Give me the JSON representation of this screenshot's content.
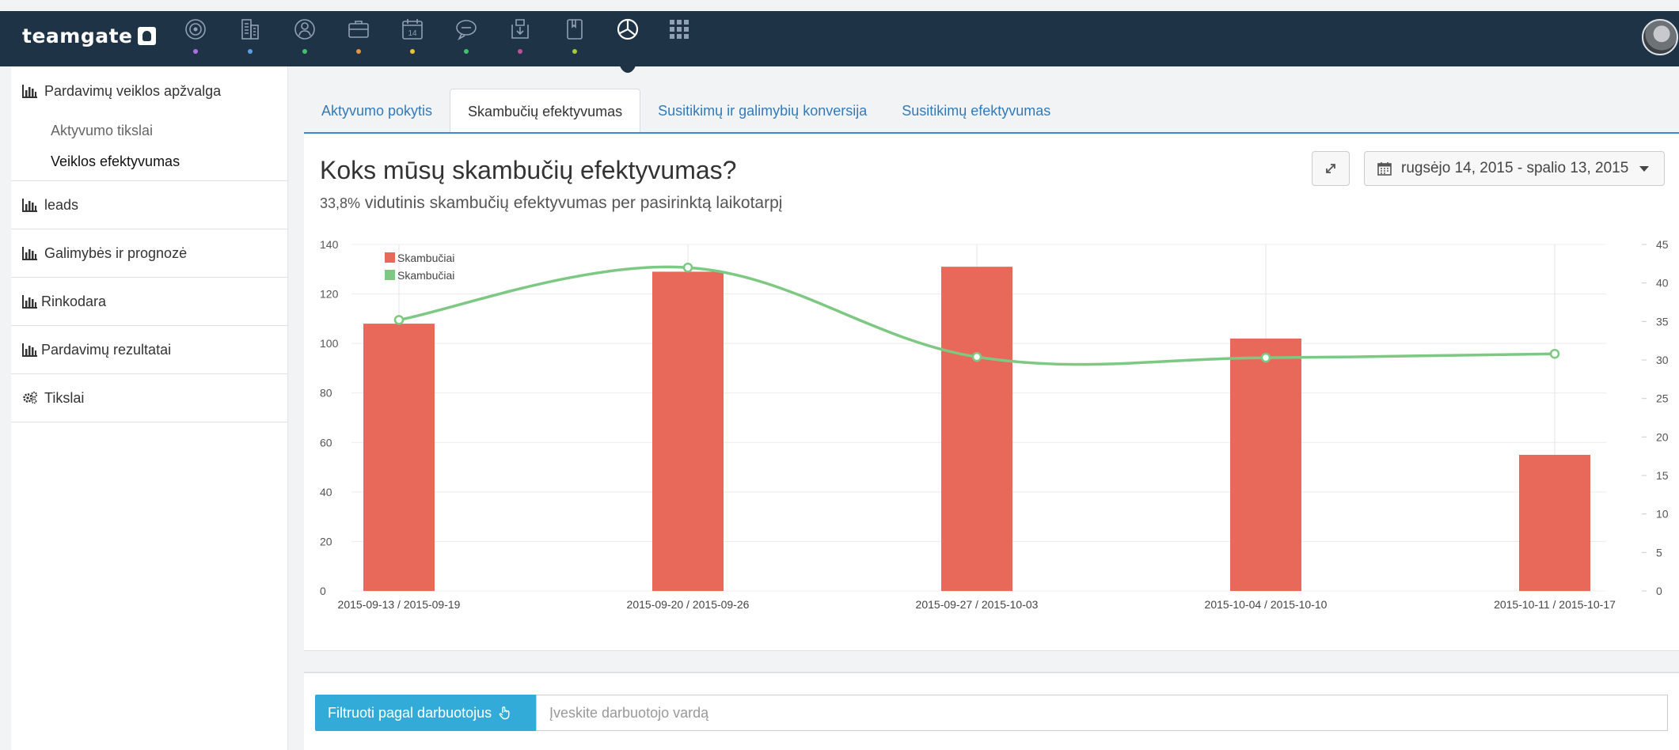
{
  "brand": {
    "name": "teamgate"
  },
  "nav": {
    "icons": [
      {
        "name": "target-icon",
        "dot": "#b06ee3"
      },
      {
        "name": "building-icon",
        "dot": "#5aa0e0"
      },
      {
        "name": "person-icon",
        "dot": "#3fc46a"
      },
      {
        "name": "briefcase-icon",
        "dot": "#e8943a"
      },
      {
        "name": "calendar-icon",
        "dot": "#e8c33a",
        "day": "14"
      },
      {
        "name": "chat-icon",
        "dot": "#3fc46a"
      },
      {
        "name": "inbox-icon",
        "dot": "#c0509a"
      },
      {
        "name": "document-icon",
        "dot": "#a8c83a"
      },
      {
        "name": "chart-pie-icon",
        "active": true
      },
      {
        "name": "apps-grid-icon"
      }
    ]
  },
  "sidebar": {
    "sections": [
      {
        "label": "Pardavimų veiklos apžvalga",
        "icon": "bar-chart-icon",
        "items": [
          {
            "label": "Aktyvumo tikslai"
          },
          {
            "label": "Veiklos efektyvumas"
          }
        ]
      },
      {
        "label": "leads",
        "icon": "bar-chart-icon"
      },
      {
        "label": "Galimybės ir prognozė",
        "icon": "bar-chart-icon"
      },
      {
        "label": "Rinkodara",
        "icon": "bar-chart-icon"
      },
      {
        "label": "Pardavimų rezultatai",
        "icon": "bar-chart-icon"
      },
      {
        "label": "Tikslai",
        "icon": "gears-icon"
      }
    ]
  },
  "tabs": [
    {
      "label": "Aktyvumo pokytis"
    },
    {
      "label": "Skambučių efektyvumas",
      "active": true
    },
    {
      "label": "Susitikimų ir galimybių konversija"
    },
    {
      "label": "Susitikimų efektyvumas"
    }
  ],
  "panel": {
    "title": "Koks mūsų skambučių efektyvumas?",
    "subtitle_value": "33,8%",
    "subtitle_text": " vidutinis skambučių efektyvumas per pasirinktą laikotarpį",
    "date_range": "rugsėjo 14, 2015 - spalio 13, 2015"
  },
  "chart_data": {
    "type": "bar",
    "categories": [
      "2015-09-13 / 2015-09-19",
      "2015-09-20 / 2015-09-26",
      "2015-09-27 / 2015-10-03",
      "2015-10-04 / 2015-10-10",
      "2015-10-11 / 2015-10-17"
    ],
    "series": [
      {
        "name": "Skambučiai",
        "type": "bar",
        "axis": "left",
        "color": "#e8685a",
        "values": [
          108,
          129,
          131,
          102,
          55
        ]
      },
      {
        "name": "Skambučiai",
        "type": "line",
        "axis": "right",
        "color": "#7dc882",
        "values": [
          35.2,
          42.0,
          30.4,
          30.3,
          30.8
        ]
      }
    ],
    "y_left": {
      "ticks": [
        "0",
        "20",
        "40",
        "60",
        "80",
        "100",
        "120",
        "140"
      ],
      "ylim": [
        0,
        140
      ]
    },
    "y_right": {
      "ticks": [
        "0",
        "5",
        "10",
        "15",
        "20",
        "25",
        "30",
        "35",
        "40",
        "45"
      ],
      "ylim": [
        0,
        45
      ]
    },
    "grid": true,
    "legend_position": "top-left"
  },
  "filter": {
    "button_label": "Filtruoti pagal darbuotojus",
    "placeholder": "Įveskite darbuotojo vardą"
  },
  "colors": {
    "topbar": "#1f3347",
    "link": "#337ab7",
    "accent": "#3a8ad1",
    "filter_button": "#33abd9"
  }
}
